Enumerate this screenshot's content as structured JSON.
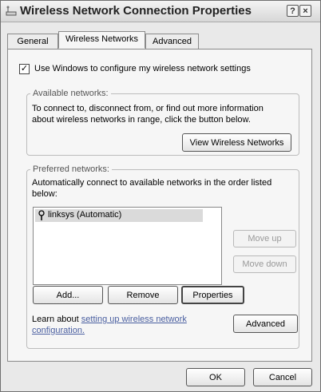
{
  "window": {
    "title": "Wireless Network Connection Properties",
    "help_glyph": "?",
    "close_glyph": "×"
  },
  "tabs": [
    {
      "label": "General"
    },
    {
      "label": "Wireless Networks"
    },
    {
      "label": "Advanced"
    }
  ],
  "use_windows": {
    "label": "Use Windows to configure my wireless network settings",
    "checked": true,
    "check_glyph": "✓"
  },
  "available": {
    "legend": "Available networks:",
    "text_line1": "To connect to, disconnect from, or find out more information",
    "text_line2": "about wireless networks in range, click the button below.",
    "button": "View Wireless Networks"
  },
  "preferred": {
    "legend": "Preferred networks:",
    "text_line1": "Automatically connect to available networks in the order listed",
    "text_line2": "below:",
    "items": [
      {
        "label": "linksys (Automatic)",
        "icon": "antenna-icon"
      }
    ],
    "move_up": "Move up",
    "move_down": "Move down",
    "add": "Add...",
    "remove": "Remove",
    "properties": "Properties",
    "learn_prefix": "Learn about ",
    "learn_link_line1": "setting up wireless network",
    "learn_link_line2": "configuration.",
    "advanced": "Advanced"
  },
  "footer": {
    "ok": "OK",
    "cancel": "Cancel"
  }
}
